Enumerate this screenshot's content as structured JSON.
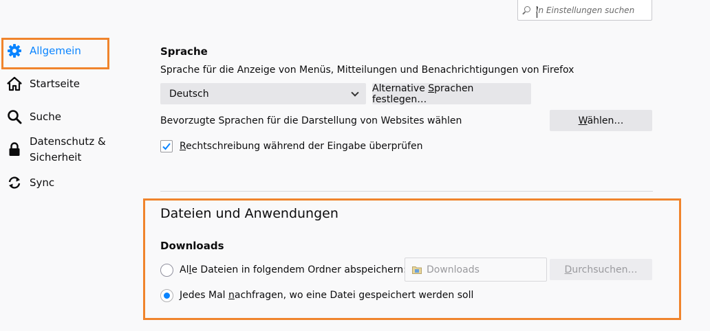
{
  "search": {
    "placeholder": "In Einstellungen suchen"
  },
  "sidebar": {
    "items": [
      {
        "label": "Allgemein",
        "icon": "gear-icon",
        "active": true
      },
      {
        "label": "Startseite",
        "icon": "home-icon"
      },
      {
        "label": "Suche",
        "icon": "search-icon"
      },
      {
        "label_line1": "Datenschutz &",
        "label_line2": "Sicherheit",
        "icon": "lock-icon"
      },
      {
        "label": "Sync",
        "icon": "sync-icon"
      }
    ]
  },
  "language": {
    "heading": "Sprache",
    "description": "Sprache für die Anzeige von Menüs, Mitteilungen und Benachrichtigungen von Firefox",
    "selected": "Deutsch",
    "alt_button_pre": "Alternative ",
    "alt_button_key": "S",
    "alt_button_post": "prachen festlegen…",
    "preferred_text": "Bevorzugte Sprachen für die Darstellung von Websites wählen",
    "choose_button_key": "W",
    "choose_button_post": "ählen…",
    "spell_key": "R",
    "spell_post": "echtschreibung während der Eingabe überprüfen",
    "spell_checked": true
  },
  "files": {
    "heading": "Dateien und Anwendungen",
    "downloads_heading": "Downloads",
    "option1_pre": "Al",
    "option1_key": "l",
    "option1_post": "e Dateien in folgendem Ordner abspeichern:",
    "folder_value": "Downloads",
    "browse_key": "D",
    "browse_post": "urchsuchen…",
    "option2_pre": "Jedes Mal ",
    "option2_key": "n",
    "option2_post": "achfragen, wo eine Datei gespeichert werden soll",
    "selected_option": 2
  },
  "colors": {
    "accent": "#0a84ff",
    "highlight_box": "#f0842c"
  }
}
